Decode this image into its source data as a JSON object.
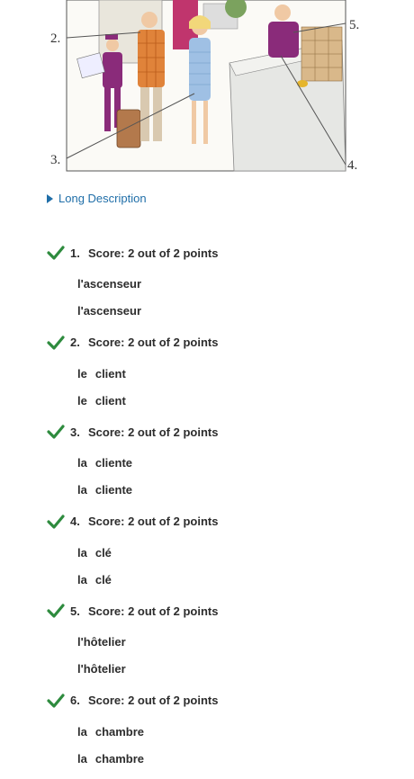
{
  "illustration": {
    "labels": [
      "2.",
      "3.",
      "4.",
      "5."
    ]
  },
  "long_description": {
    "label": "Long Description"
  },
  "score_prefix": "Score:",
  "questions": [
    {
      "number": "1.",
      "score_text": "Score: 2 out of 2 points",
      "article": "",
      "word": "l'ascenseur",
      "answer": "l'ascenseur",
      "correct": "l'ascenseur"
    },
    {
      "number": "2.",
      "score_text": "Score: 2 out of 2 points",
      "article": "le",
      "word": "client",
      "answer": "le client",
      "correct": "le client"
    },
    {
      "number": "3.",
      "score_text": "Score: 2 out of 2 points",
      "article": "la",
      "word": "cliente",
      "answer": "la cliente",
      "correct": "la cliente"
    },
    {
      "number": "4.",
      "score_text": "Score: 2 out of 2 points",
      "article": "la",
      "word": "clé",
      "answer": "la clé",
      "correct": "la clé"
    },
    {
      "number": "5.",
      "score_text": "Score: 2 out of 2 points",
      "article": "",
      "word": "l'hôtelier",
      "answer": "l'hôtelier",
      "correct": "l'hôtelier"
    },
    {
      "number": "6.",
      "score_text": "Score: 2 out of 2 points",
      "article": "la",
      "word": "chambre",
      "answer": "la chambre",
      "correct": "la chambre"
    }
  ],
  "colors": {
    "check": "#2e8b3e",
    "link": "#1f6ea8"
  }
}
